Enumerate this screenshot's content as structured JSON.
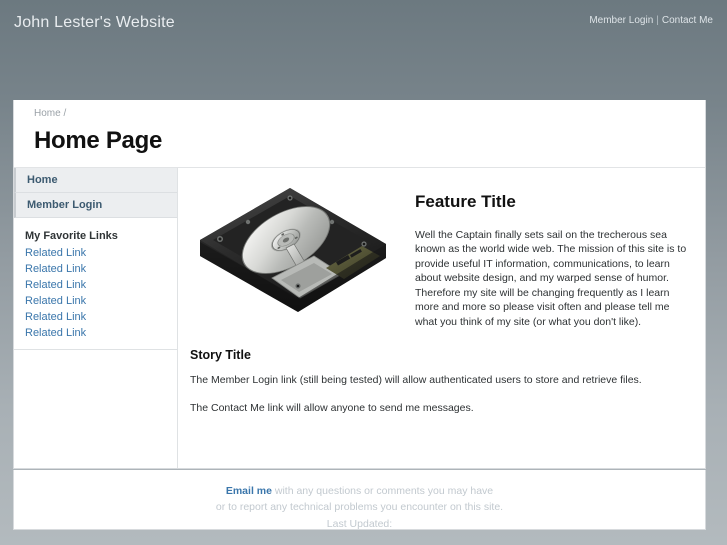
{
  "header": {
    "site_title": "John Lester's Website",
    "nav": [
      {
        "label": "Member Login"
      },
      {
        "label": "Contact Me"
      }
    ],
    "separator": "|"
  },
  "titlebar": {
    "breadcrumb_home": "Home",
    "breadcrumb_sep": "/",
    "page_title": "Home Page"
  },
  "sidebar": {
    "nav_items": [
      {
        "label": "Home"
      },
      {
        "label": "Member Login"
      }
    ],
    "links_heading": "My Favorite Links",
    "links": [
      {
        "label": "Related Link"
      },
      {
        "label": "Related Link"
      },
      {
        "label": "Related Link"
      },
      {
        "label": "Related Link"
      },
      {
        "label": "Related Link"
      },
      {
        "label": "Related Link"
      }
    ]
  },
  "feature": {
    "image_alt": "hard-disk-drive-photo",
    "title": "Feature Title",
    "body": "Well the Captain finally sets sail on the trecherous sea known as the world wide web. The mission of this site is to provide useful IT information, communications, to learn about website design, and my warped sense of humor. Therefore my site will be changing frequently as I learn more and more so please visit often and please tell me what you think of my site (or what you don't like)."
  },
  "story": {
    "title": "Story Title",
    "paragraphs": [
      "The Member Login link (still being tested) will allow authenticated users to store and retrieve files.",
      "The Contact Me link will allow anyone to send me messages."
    ]
  },
  "footer": {
    "email_link": "Email me",
    "line1_rest": " with any questions or comments you may have",
    "line2": "or to report any technical problems you encounter on this site.",
    "line3": "Last Updated:"
  },
  "colors": {
    "header_top": "#6c7980",
    "page_bottom": "#b3babe",
    "link_blue": "#3a76ab",
    "sidebar_nav_bg": "#eceef0",
    "sidebar_nav_text": "#3c5a70",
    "card_white": "#ffffff",
    "muted_footer": "#c2c9cf"
  }
}
